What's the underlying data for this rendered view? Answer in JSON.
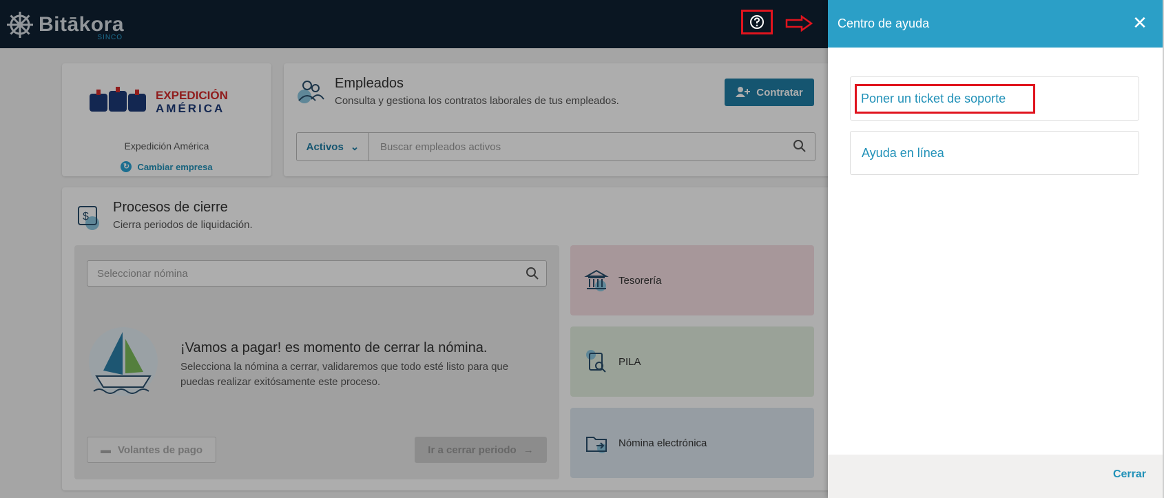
{
  "app": {
    "logo_name": "Bitākora",
    "logo_sub": "SINCO"
  },
  "company": {
    "logo_line1": "EXPEDICIÓN",
    "logo_line2": "AMÉRICA",
    "name": "Expedición América",
    "change_label": "Cambiar empresa"
  },
  "employees": {
    "title": "Empleados",
    "description": "Consulta y gestiona los contratos laborales de tus empleados.",
    "hire_label": "Contratar",
    "status_value": "Activos",
    "search_placeholder": "Buscar empleados activos"
  },
  "closing": {
    "title": "Procesos de cierre",
    "description": "Cierra periodos de liquidación.",
    "nomina_placeholder": "Seleccionar nómina",
    "pay_title": "¡Vamos a pagar! es momento de cerrar la nómina.",
    "pay_description": "Selecciona la nómina a cerrar, validaremos que todo esté listo para que puedas realizar exitósamente este proceso.",
    "vouchers_label": "Volantes de pago",
    "go_label": "Ir a cerrar periodo",
    "tiles": [
      "Tesorería",
      "PILA",
      "Nómina electrónica"
    ]
  },
  "drawer": {
    "title": "Centro de ayuda",
    "items": [
      "Poner un ticket de soporte",
      "Ayuda en línea"
    ],
    "close_label": "Cerrar"
  },
  "colors": {
    "topbar": "#0f2133",
    "accent": "#2b9fc7",
    "annotation": "#e0141e"
  }
}
